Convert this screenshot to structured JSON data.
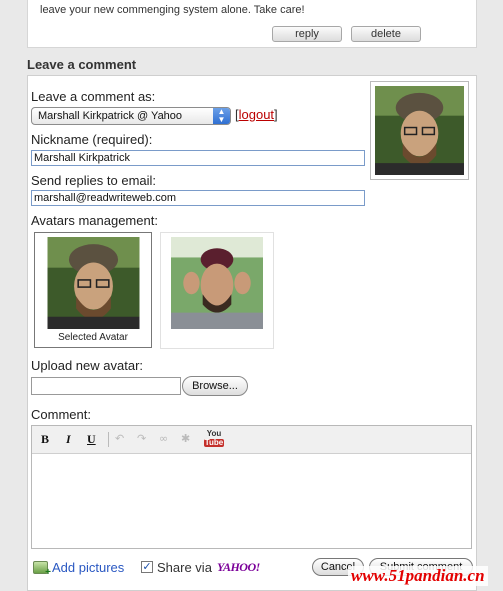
{
  "previous_comment": {
    "text": "leave your new commenging system alone.  Take care!",
    "reply_label": "reply",
    "delete_label": "delete"
  },
  "section_title": "Leave a comment",
  "form": {
    "leave_as_label": "Leave a comment as:",
    "account_selected": "Marshall Kirkpatrick @ Yahoo",
    "logout_open": "[",
    "logout_label": "logout",
    "logout_close": "]",
    "nickname_label": "Nickname (required):",
    "nickname_value": "Marshall Kirkpatrick",
    "email_label": "Send replies to email:",
    "email_value": "marshall@readwriteweb.com",
    "avatars_label": "Avatars management:",
    "selected_avatar_caption": "Selected Avatar",
    "upload_label": "Upload new avatar:",
    "upload_value": "",
    "browse_label": "Browse...",
    "comment_label": "Comment:",
    "comment_value": ""
  },
  "toolbar": {
    "bold": "B",
    "italic": "I",
    "underline": "U",
    "youtube_top": "You",
    "youtube_bottom": "Tube"
  },
  "footer": {
    "add_pictures": "Add pictures",
    "share_checked": true,
    "share_label": "Share via",
    "share_service": "YAHOO!",
    "cancel_label": "Cancel",
    "submit_label": "Submit comment"
  },
  "watermark": "www.51pandian.cn",
  "colors": {
    "link_blue": "#2a58c2",
    "logout_red": "#b00000",
    "yahoo_purple": "#7b0099",
    "watermark_red": "#e30000"
  }
}
